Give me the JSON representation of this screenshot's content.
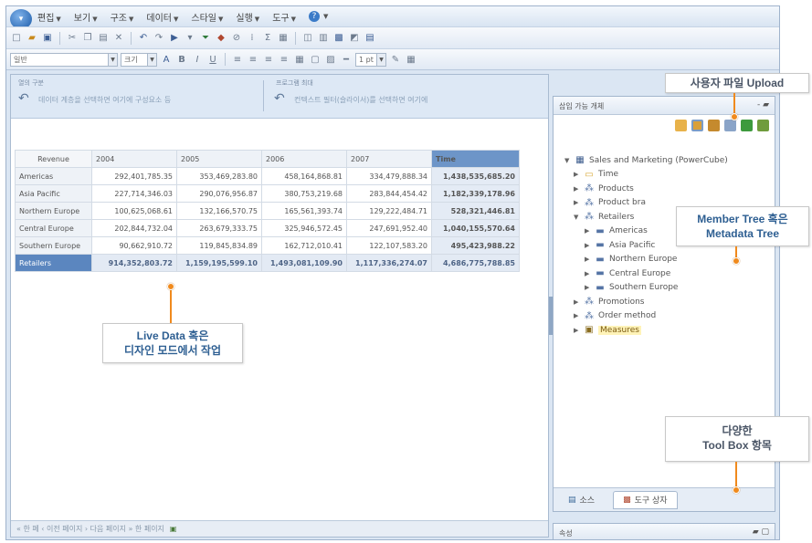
{
  "menu": {
    "items": [
      "편집",
      "보기",
      "구조",
      "데이터",
      "스타일",
      "실행",
      "도구"
    ]
  },
  "toolbar2": {
    "style_combo": "일반",
    "size_combo": "크기",
    "line_width": "1 pt"
  },
  "dropzones": {
    "left_title": "열의 구분",
    "left_text": "데이터 계층을 선택하면 여기에 구성요소 등",
    "right_title": "프로그램 최대",
    "right_text": "컨텍스트 필터(슬라이서)를 선택하면 여기에"
  },
  "crosstab": {
    "corner": "Revenue",
    "columns": [
      "2004",
      "2005",
      "2006",
      "2007",
      "Time"
    ],
    "rows": [
      {
        "label": "Americas",
        "values": [
          "292,401,785.35",
          "353,469,283.80",
          "458,164,868.81",
          "334,479,888.34",
          "1,438,535,685.20"
        ]
      },
      {
        "label": "Asia Pacific",
        "values": [
          "227,714,346.03",
          "290,076,956.87",
          "380,753,219.68",
          "283,844,454.42",
          "1,182,339,178.96"
        ]
      },
      {
        "label": "Northern Europe",
        "values": [
          "100,625,068.61",
          "132,166,570.75",
          "165,561,393.74",
          "129,222,484.71",
          "528,321,446.81"
        ]
      },
      {
        "label": "Central Europe",
        "values": [
          "202,844,732.04",
          "263,679,333.75",
          "325,946,572.45",
          "247,691,952.40",
          "1,040,155,570.64"
        ]
      },
      {
        "label": "Southern Europe",
        "values": [
          "90,662,910.72",
          "119,845,834.89",
          "162,712,010.41",
          "122,107,583.20",
          "495,423,988.22"
        ]
      }
    ],
    "total_row": {
      "label": "Retailers",
      "values": [
        "914,352,803.72",
        "1,159,195,599.10",
        "1,493,081,109.90",
        "1,117,336,274.07",
        "4,686,775,788.85"
      ]
    }
  },
  "statusbar": {
    "text": "« 한 페  ‹ 이전 페이지  › 다음 페이지  » 한 페이지"
  },
  "insertable_panel": {
    "title": "삽입 가능 개체",
    "buttons": "- ▰"
  },
  "tree": {
    "root": "Sales and Marketing (PowerCube)",
    "items": [
      {
        "label": "Time",
        "icon": "folder-icon",
        "level": 1,
        "expanded": false
      },
      {
        "label": "Products",
        "icon": "dimension-icon",
        "level": 1,
        "expanded": false
      },
      {
        "label": "Product bra",
        "icon": "dimension-icon",
        "level": 1,
        "expanded": false
      },
      {
        "label": "Retailers",
        "icon": "dimension-icon",
        "level": 1,
        "expanded": true
      },
      {
        "label": "Americas",
        "icon": "level-icon",
        "level": 2,
        "expanded": false
      },
      {
        "label": "Asia Pacific",
        "icon": "level-icon",
        "level": 2,
        "expanded": false
      },
      {
        "label": "Northern Europe",
        "icon": "level-icon",
        "level": 2,
        "expanded": false
      },
      {
        "label": "Central Europe",
        "icon": "level-icon",
        "level": 2,
        "expanded": false
      },
      {
        "label": "Southern Europe",
        "icon": "level-icon",
        "level": 2,
        "expanded": false
      },
      {
        "label": "Promotions",
        "icon": "dimension-icon",
        "level": 1,
        "expanded": false
      },
      {
        "label": "Order method",
        "icon": "dimension-icon",
        "level": 1,
        "expanded": false
      },
      {
        "label": "Measures",
        "icon": "measures-icon",
        "level": 1,
        "expanded": false
      }
    ]
  },
  "panel_tabs": {
    "source": "소스",
    "toolbox": "도구 상자"
  },
  "properties_panel": {
    "title": "속성"
  },
  "callouts": {
    "upload": "사용자 파일 Upload",
    "tree_line1": "Member Tree 혹은",
    "tree_line2": "Metadata Tree",
    "live_line1": "Live Data 혹은",
    "live_line2": "디자인 모드에서 작업",
    "toolbox_line1": "다양한",
    "toolbox_line2": "Tool Box 항목"
  },
  "colors": {
    "accent_orange": "#f08a1d",
    "header_blue": "#6d95c8"
  }
}
